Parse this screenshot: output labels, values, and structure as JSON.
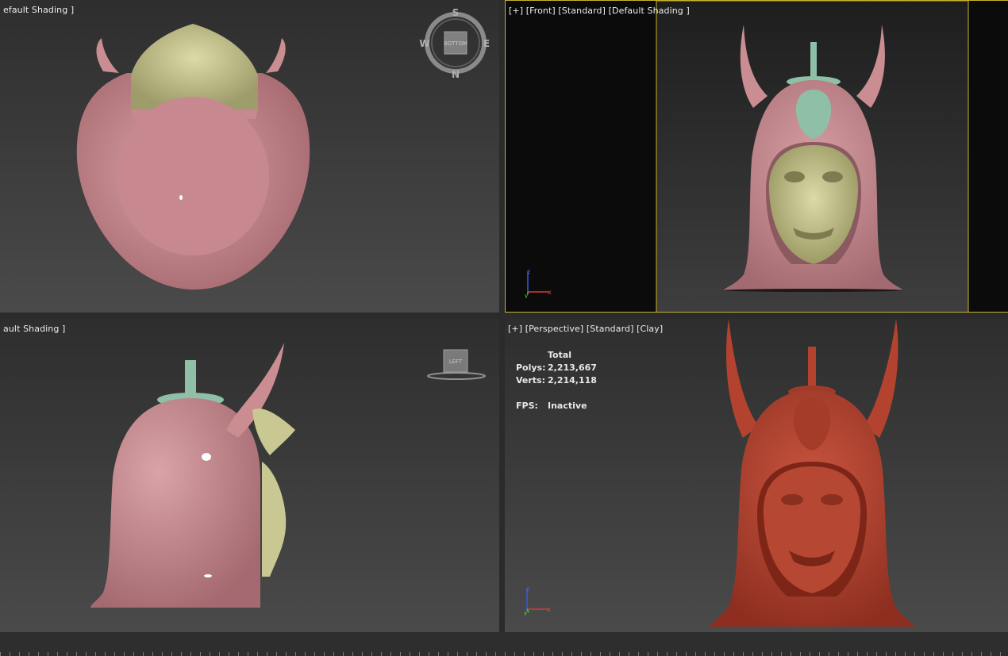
{
  "viewports": {
    "top_left": {
      "label": "efault Shading ]",
      "compass": {
        "n": "N",
        "s": "S",
        "e": "E",
        "w": "W",
        "cube_face": "BOTTOM"
      }
    },
    "top_right": {
      "label": "[+] [Front] [Standard] [Default Shading ]",
      "axis": {
        "x": "x",
        "z": "z",
        "y": "y"
      }
    },
    "bottom_left": {
      "label": "ault Shading ]",
      "cube_face": "LEFT"
    },
    "bottom_right": {
      "label": "[+] [Perspective] [Standard] [Clay]",
      "stats": {
        "header": "Total",
        "polys_label": "Polys:",
        "polys_value": "2,213,667",
        "verts_label": "Verts:",
        "verts_value": "2,214,118",
        "fps_label": "FPS:",
        "fps_value": "Inactive"
      },
      "axis": {
        "x": "x",
        "z": "z",
        "y": "y"
      }
    }
  },
  "colors": {
    "helmet_pink": "#c98d92",
    "mask_yellow": "#c9c792",
    "finial_green": "#8fbfa6",
    "clay_red": "#b3432f",
    "selection_yellow": "#c9b42a"
  }
}
